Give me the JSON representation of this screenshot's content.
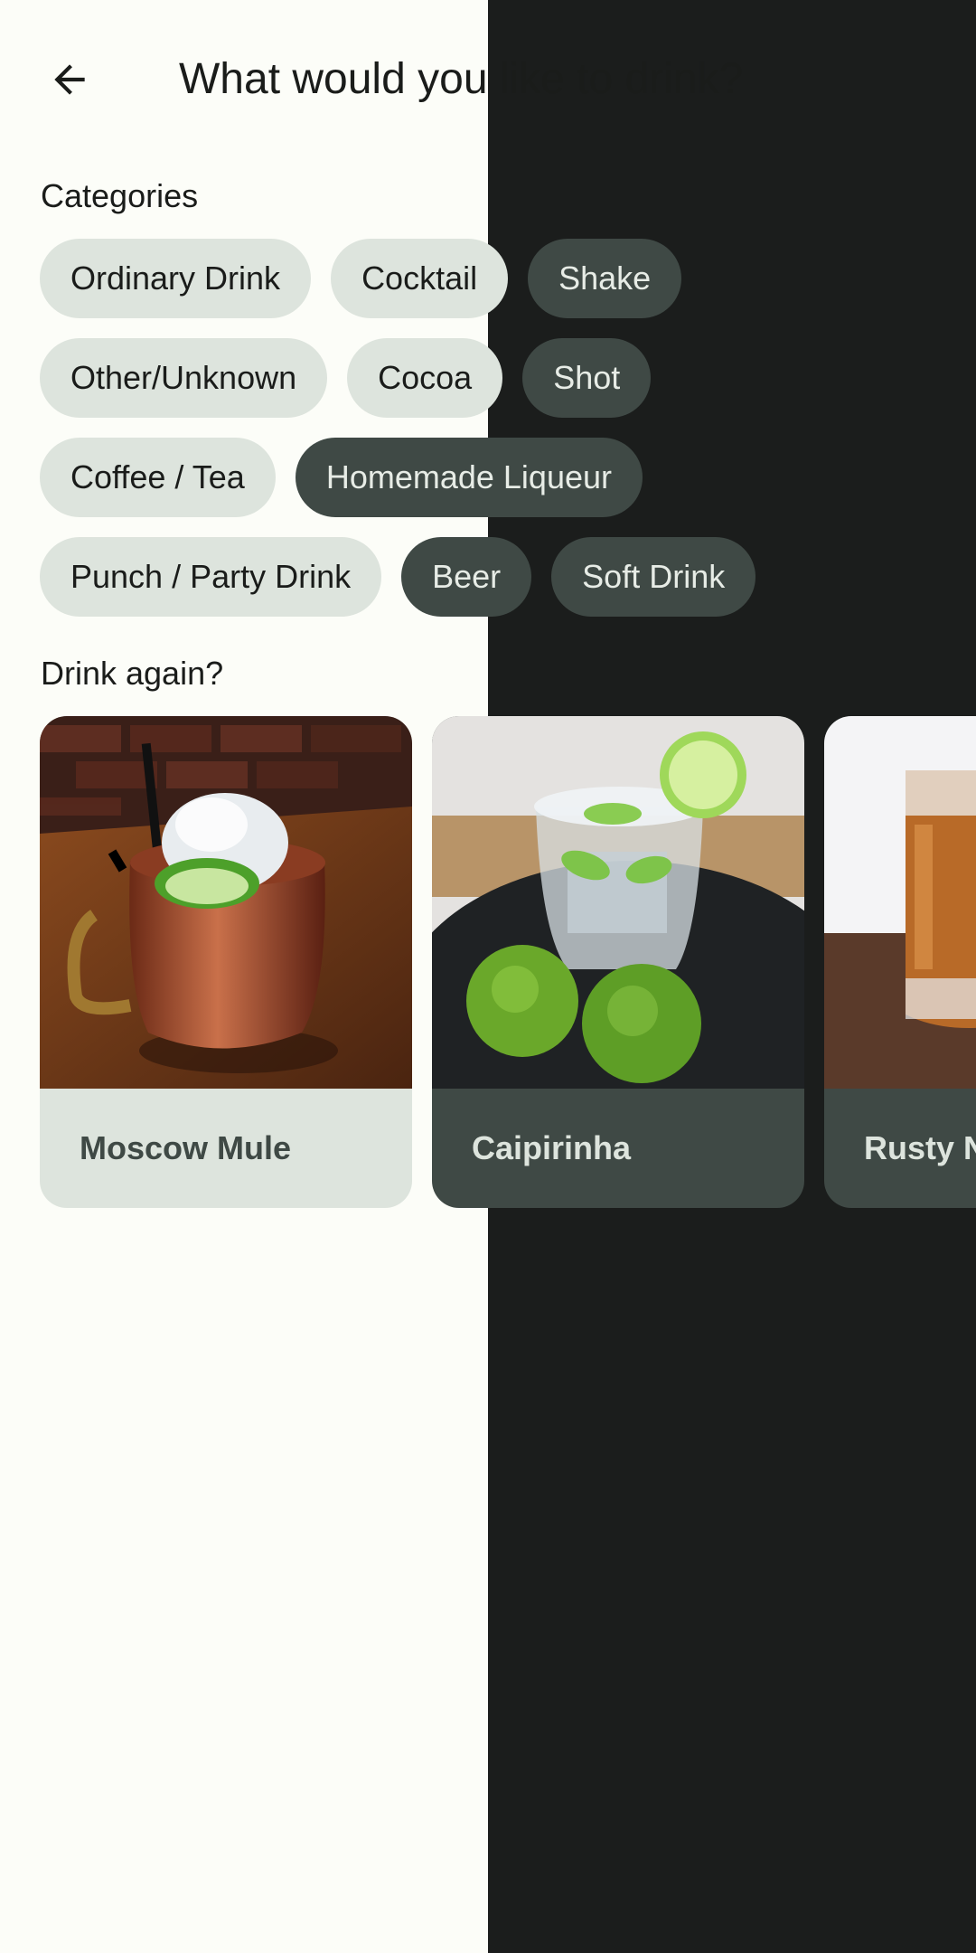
{
  "header": {
    "title": "What would you like to drink?"
  },
  "categories": {
    "title": "Categories",
    "rows": [
      [
        "Ordinary Drink",
        "Cocktail",
        "Shake"
      ],
      [
        "Other/Unknown",
        "Cocoa",
        "Shot"
      ],
      [
        "Coffee / Tea",
        "Homemade Liqueur"
      ],
      [
        "Punch / Party Drink",
        "Beer",
        "Soft Drink"
      ]
    ]
  },
  "drink_again": {
    "title": "Drink again?",
    "items": [
      {
        "name": "Moscow Mule"
      },
      {
        "name": "Caipirinha"
      },
      {
        "name": "Rusty N"
      }
    ]
  },
  "colors": {
    "background_light": "#fcfdf8",
    "background_dark": "#1b1d1c",
    "chip_light": "#dde4dd",
    "chip_dark": "#3f4945"
  },
  "icons": {
    "back": "arrow-back-icon"
  }
}
